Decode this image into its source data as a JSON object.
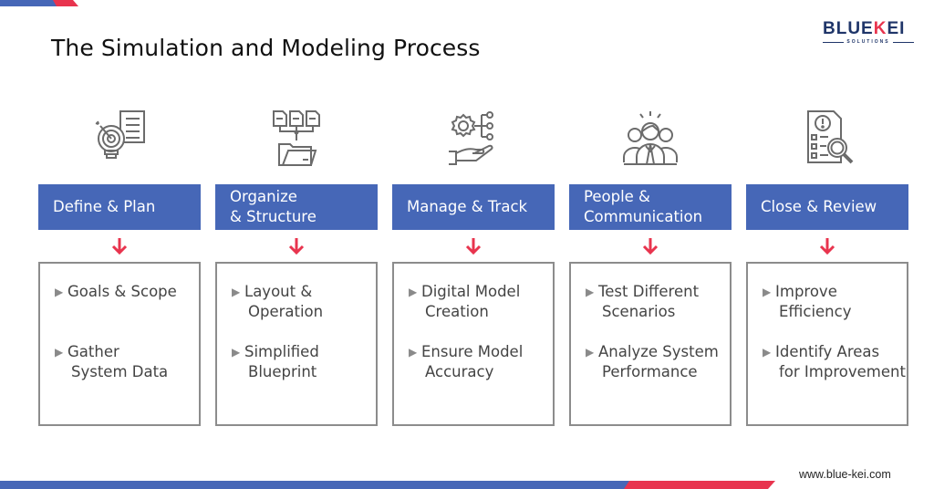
{
  "title": "The Simulation and Modeling Process",
  "logo": {
    "brand_left": "BLUE",
    "brand_k": "K",
    "brand_right": "EI",
    "tagline": "SOLUTIONS"
  },
  "colors": {
    "primary_blue": "#4667b7",
    "accent_red": "#e8344e",
    "logo_navy": "#1f3569",
    "border_gray": "#8c8c8c",
    "text_gray": "#444444"
  },
  "stages": [
    {
      "icon": "target-lightbulb-checklist-icon",
      "heading_line1": "Define & Plan",
      "heading_line2": "",
      "bullets": [
        {
          "line1": "Goals & Scope",
          "line2": ""
        },
        {
          "line1": "Gather",
          "line2": "System Data"
        }
      ]
    },
    {
      "icon": "documents-folder-icon",
      "heading_line1": "Organize",
      "heading_line2": "& Structure",
      "bullets": [
        {
          "line1": "Layout &",
          "line2": "Operation"
        },
        {
          "line1": "Simplified",
          "line2": "Blueprint"
        }
      ]
    },
    {
      "icon": "gear-network-hand-icon",
      "heading_line1": "Manage & Track",
      "heading_line2": "",
      "bullets": [
        {
          "line1": "Digital Model",
          "line2": "Creation"
        },
        {
          "line1": "Ensure Model",
          "line2": "Accuracy"
        }
      ]
    },
    {
      "icon": "team-people-icon",
      "heading_line1": "People &",
      "heading_line2": "Communication",
      "bullets": [
        {
          "line1": "Test Different",
          "line2": "Scenarios"
        },
        {
          "line1": "Analyze System",
          "line2": "Performance"
        }
      ]
    },
    {
      "icon": "document-magnifier-icon",
      "heading_line1": "Close & Review",
      "heading_line2": "",
      "bullets": [
        {
          "line1": "Improve",
          "line2": "Efficiency"
        },
        {
          "line1": "Identify Areas",
          "line2": "for Improvement"
        }
      ]
    }
  ],
  "bullet_glyph": "▶",
  "footer_url": "www.blue-kei.com"
}
